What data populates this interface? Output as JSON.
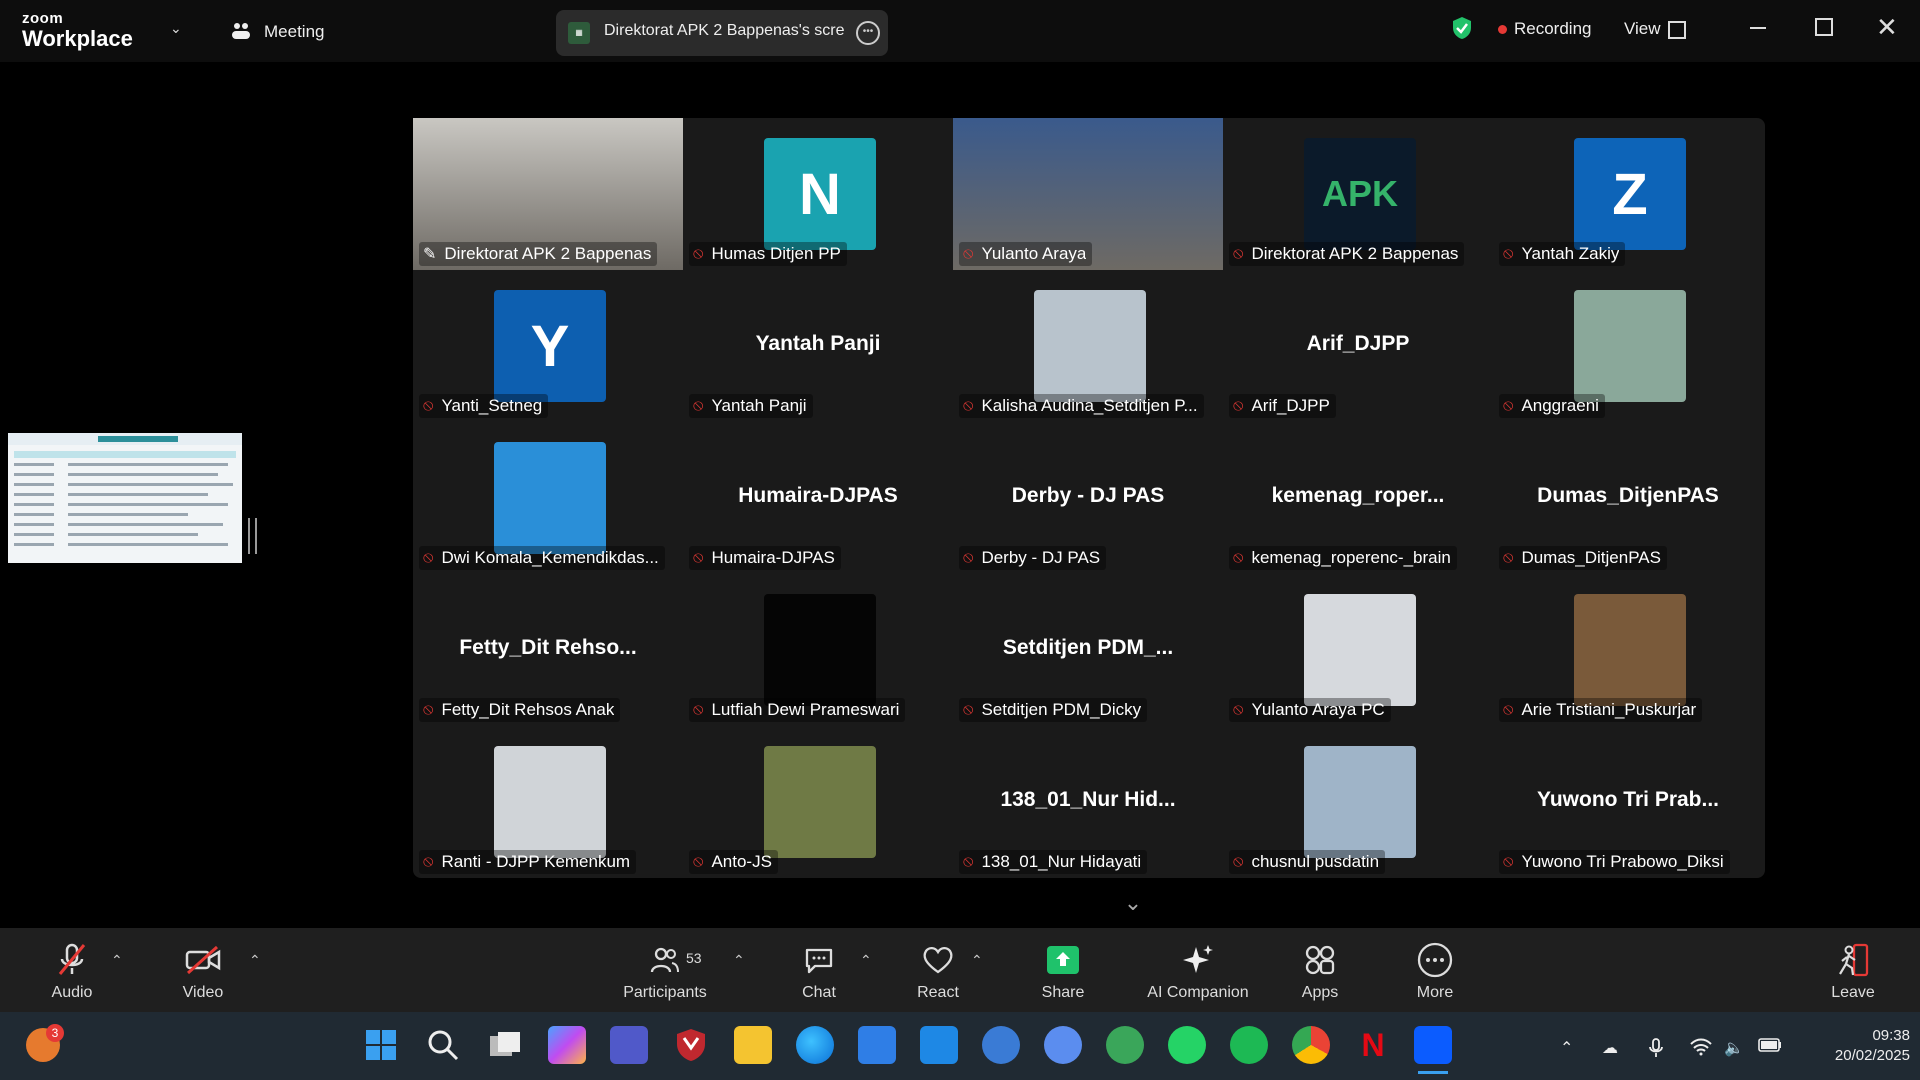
{
  "titlebar": {
    "logo_top": "zoom",
    "logo_bottom": "Workplace",
    "meeting_label": "Meeting",
    "share_label": "Direktorat APK 2 Bappenas's scre",
    "recording_label": "Recording",
    "view_label": "View"
  },
  "tiles": [
    {
      "name": "Direktorat APK 2 Bappenas",
      "kind": "video",
      "bg": "#c9c7c2",
      "active": true,
      "mic": "pinned"
    },
    {
      "name": "Humas Ditjen PP",
      "kind": "avatar",
      "letter": "N",
      "color": "#1aa3b0"
    },
    {
      "name": "Yulanto Araya",
      "kind": "video",
      "bg": "#3a5a8c"
    },
    {
      "name": "Direktorat APK 2 Bappenas",
      "kind": "logo",
      "text": "APK",
      "color": "#0b1a2a"
    },
    {
      "name": "Yantah Zakiy",
      "kind": "avatar",
      "letter": "Z",
      "color": "#0d64b8"
    },
    {
      "name": "Yanti_Setneg",
      "kind": "avatar",
      "letter": "Y",
      "color": "#0d5fb0"
    },
    {
      "name": "Yantah Panji",
      "kind": "text",
      "big": "Yantah Panji"
    },
    {
      "name": "Kalisha Audina_Setditjen P...",
      "kind": "photo",
      "bg": "#b8c3cc"
    },
    {
      "name": "Arif_DJPP",
      "kind": "text",
      "big": "Arif_DJPP"
    },
    {
      "name": "Anggraeni",
      "kind": "photo",
      "bg": "#8aa89a"
    },
    {
      "name": "Dwi Komala_Kemendikdas...",
      "kind": "photo",
      "bg": "#2a8fd8"
    },
    {
      "name": "Humaira-DJPAS",
      "kind": "text",
      "big": "Humaira-DJPAS"
    },
    {
      "name": "Derby - DJ PAS",
      "kind": "text",
      "big": "Derby - DJ PAS"
    },
    {
      "name": "kemenag_roperenc-_brain",
      "kind": "text",
      "big": "kemenag_roper..."
    },
    {
      "name": "Dumas_DitjenPAS",
      "kind": "text",
      "big": "Dumas_DitjenPAS"
    },
    {
      "name": "Fetty_Dit Rehsos Anak",
      "kind": "text",
      "big": "Fetty_Dit Rehso..."
    },
    {
      "name": "Lutfiah Dewi Prameswari",
      "kind": "photo",
      "bg": "#050505"
    },
    {
      "name": "Setditjen PDM_Dicky",
      "kind": "text",
      "big": "Setditjen PDM_..."
    },
    {
      "name": "Yulanto Araya PC",
      "kind": "photo",
      "bg": "#d6d9dd"
    },
    {
      "name": "Arie Tristiani_Puskurjar",
      "kind": "photo",
      "bg": "#7a5a3a"
    },
    {
      "name": "Ranti - DJPP Kemenkum",
      "kind": "photo",
      "bg": "#d0d4d8"
    },
    {
      "name": "Anto-JS",
      "kind": "photo",
      "bg": "#6f7a45"
    },
    {
      "name": "138_01_Nur Hidayati",
      "kind": "text",
      "big": "138_01_Nur Hid..."
    },
    {
      "name": "chusnul pusdatin",
      "kind": "photo",
      "bg": "#9fb4c8"
    },
    {
      "name": "Yuwono Tri Prabowo_Diksi",
      "kind": "text",
      "big": "Yuwono Tri Prab..."
    }
  ],
  "toolbar": {
    "audio": "Audio",
    "video": "Video",
    "participants": "Participants",
    "participants_count": "53",
    "chat": "Chat",
    "react": "React",
    "share": "Share",
    "ai": "AI Companion",
    "apps": "Apps",
    "more": "More",
    "leave": "Leave"
  },
  "taskbar": {
    "badge": "3",
    "time": "09:38",
    "date": "20/02/2025"
  },
  "colors": {
    "active_outline": "#22c26a",
    "muted_red": "#e53935",
    "share_green": "#1fc26b"
  }
}
